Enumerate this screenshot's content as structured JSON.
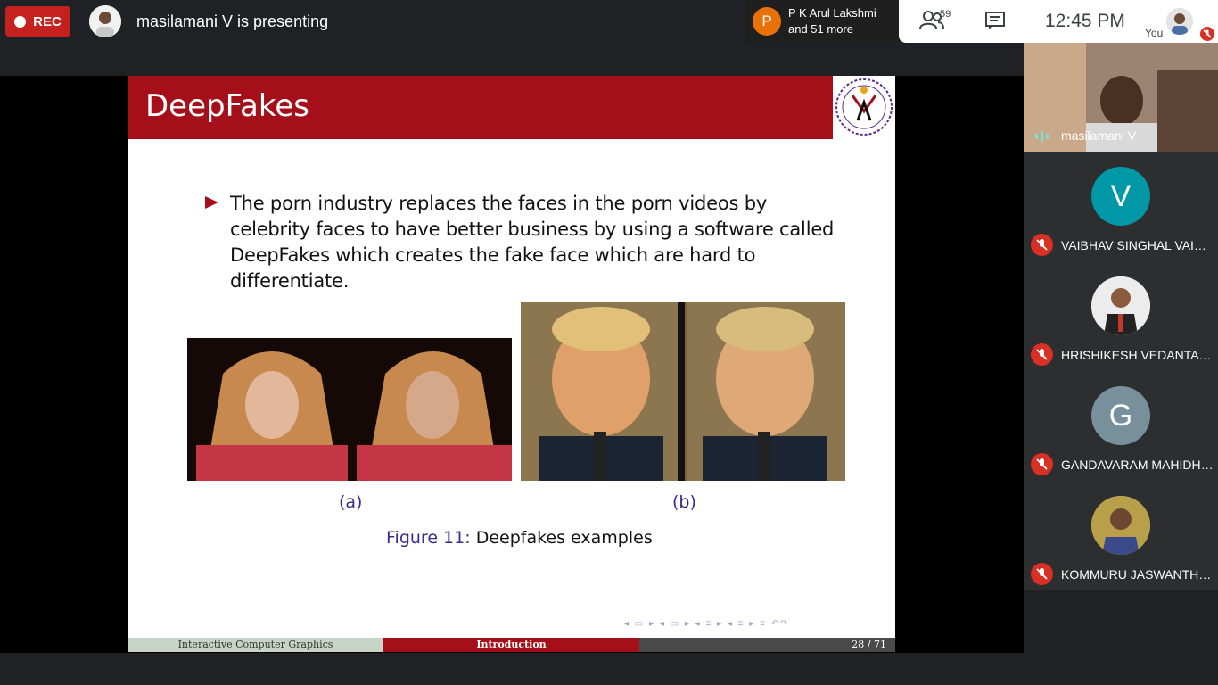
{
  "topbar": {
    "rec_label": "REC",
    "presenting_text": "masilamani V is presenting",
    "joined": {
      "avatar_letter": "P",
      "line1": "P K Arul Lakshmi",
      "line2": "and 51 more"
    },
    "participant_count": "59",
    "clock": "12:45 PM",
    "you_label": "You"
  },
  "slide": {
    "title": "DeepFakes",
    "bullet": "The porn industry replaces the faces in the porn videos by celebrity faces to have better business by using a software called DeepFakes which creates the fake face which are hard to differentiate.",
    "caption_a": "(a)",
    "caption_b": "(b)",
    "figure_label": "Figure 11:",
    "figure_text": "Deepfakes examples",
    "footer": {
      "left": "Interactive Computer Graphics",
      "center": "Introduction",
      "page": "28 / 71"
    }
  },
  "sidebar": {
    "presenter_name": "masilamani V",
    "participants": [
      {
        "initial": "V",
        "name": "VAIBHAV SINGHAL VAIBH...",
        "color": "#0097a7"
      },
      {
        "initial": "",
        "name": "HRISHIKESH VEDANTAM ...",
        "color": "#e6e6e6"
      },
      {
        "initial": "G",
        "name": "GANDAVARAM MAHIDHA...",
        "color": "#78909c"
      },
      {
        "initial": "",
        "name": "KOMMURU JASWANTH R...",
        "color": "#d9c25a"
      }
    ]
  },
  "colors": {
    "rec": "#c5221f",
    "slide_red": "#a50f19",
    "caption_blue": "#3b2a8f",
    "mic_off": "#d93025"
  }
}
